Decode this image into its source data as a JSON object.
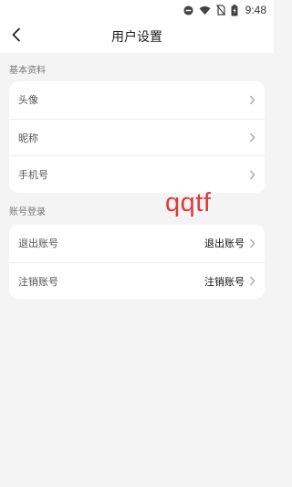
{
  "status_bar": {
    "time": "9:48",
    "icons": [
      "do-not-disturb-icon",
      "wifi-icon",
      "no-sim-icon",
      "battery-icon"
    ]
  },
  "nav": {
    "title": "用户设置",
    "back_icon": "chevron-left-icon"
  },
  "sections": [
    {
      "label": "基本资料",
      "rows": [
        {
          "label": "头像",
          "value": ""
        },
        {
          "label": "昵称",
          "value": ""
        },
        {
          "label": "手机号",
          "value": ""
        }
      ]
    },
    {
      "label": "账号登录",
      "rows": [
        {
          "label": "退出账号",
          "value": "退出账号"
        },
        {
          "label": "注销账号",
          "value": "注销账号"
        }
      ]
    }
  ],
  "watermark": "qqtf",
  "colors": {
    "background": "#f4f4f4",
    "card": "#ffffff",
    "watermark": "#e23a3a"
  }
}
